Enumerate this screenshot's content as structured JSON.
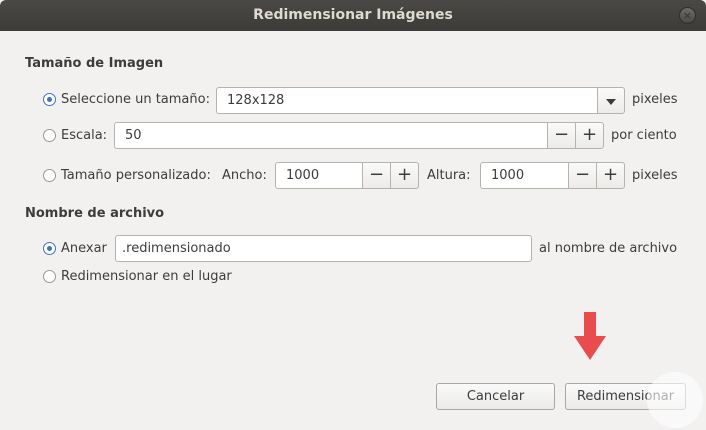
{
  "window": {
    "title": "Redimensionar Imágenes",
    "close_icon": "close-icon"
  },
  "image_size": {
    "section_title": "Tamaño de Imagen",
    "option_size": {
      "label": "Seleccione un tamaño:",
      "selected": true,
      "value": "128x128",
      "unit": "pixeles"
    },
    "option_scale": {
      "label": "Escala:",
      "selected": false,
      "value": "50",
      "unit": "por ciento",
      "minus": "−",
      "plus": "+"
    },
    "option_custom": {
      "label": "Tamaño personalizado:",
      "selected": false,
      "width_label": "Ancho:",
      "width_value": "1000",
      "height_label": "Altura:",
      "height_value": "1000",
      "unit": "pixeles",
      "minus": "−",
      "plus": "+"
    }
  },
  "file_name": {
    "section_title": "Nombre de archivo",
    "option_append": {
      "label": "Anexar",
      "selected": true,
      "value": ".redimensionado",
      "suffix": "al nombre de archivo"
    },
    "option_inplace": {
      "label": "Redimensionar en el lugar",
      "selected": false
    }
  },
  "actions": {
    "cancel_label": "Cancelar",
    "resize_label": "Redimensionar"
  },
  "colors": {
    "titlebar": "#3c3b37",
    "accent": "#3f73bd",
    "arrow": "#e84c4c"
  }
}
